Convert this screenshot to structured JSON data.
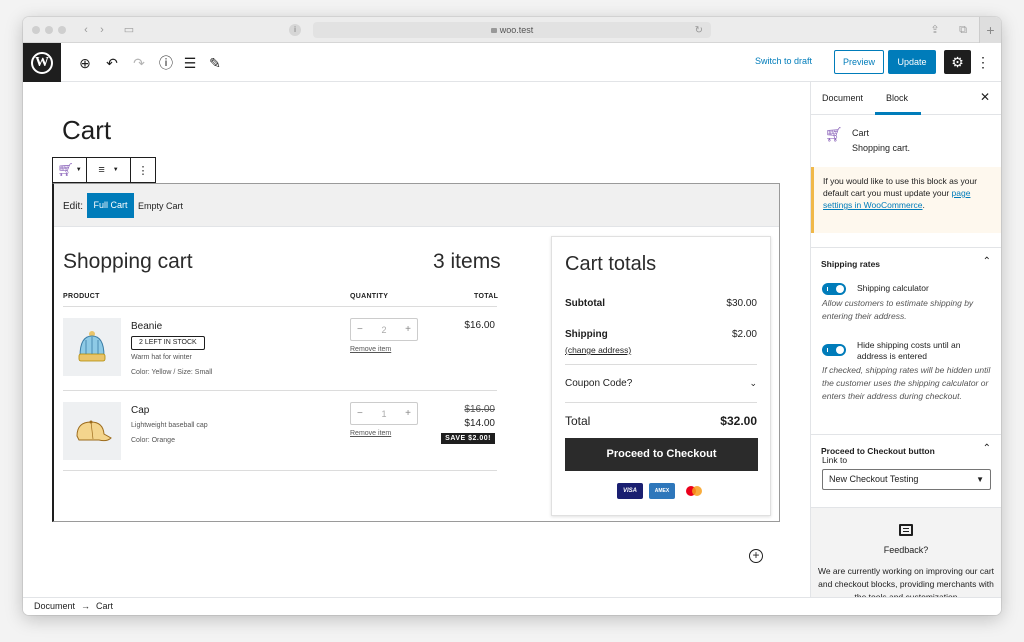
{
  "browser": {
    "url": "woo.test"
  },
  "toolbar": {
    "switch_draft": "Switch to draft",
    "preview": "Preview",
    "update": "Update"
  },
  "page": {
    "title": "Cart"
  },
  "block": {
    "edit_label": "Edit:",
    "full_cart": "Full Cart",
    "empty_cart": "Empty Cart"
  },
  "cart": {
    "title": "Shopping cart",
    "count": "3 items",
    "col_product": "PRODUCT",
    "col_quantity": "QUANTITY",
    "col_total": "TOTAL",
    "remove_label": "Remove item",
    "items": [
      {
        "name": "Beanie",
        "stock": "2 LEFT IN STOCK",
        "desc": "Warm hat for winter",
        "attrs": "Color: Yellow / Size: Small",
        "qty": "2",
        "price": "$16.00"
      },
      {
        "name": "Cap",
        "desc": "Lightweight baseball cap",
        "attrs": "Color: Orange",
        "qty": "1",
        "old_price": "$16.00",
        "price": "$14.00",
        "save": "SAVE $2.00!"
      }
    ]
  },
  "totals": {
    "title": "Cart totals",
    "subtotal_label": "Subtotal",
    "subtotal": "$30.00",
    "shipping_label": "Shipping",
    "shipping": "$2.00",
    "change_address": "(change address)",
    "coupon": "Coupon Code?",
    "total_label": "Total",
    "total": "$32.00",
    "checkout": "Proceed to Checkout",
    "cards": [
      "VISA",
      "AMEX",
      "MC"
    ]
  },
  "sidebar": {
    "tab_document": "Document",
    "tab_block": "Block",
    "block_name": "Cart",
    "block_desc": "Shopping cart.",
    "notice_pre": "If you would like to use this block as your default cart you must update your ",
    "notice_link": "page settings in WooCommerce",
    "notice_post": ".",
    "shipping_rates_title": "Shipping rates",
    "toggle1_label": "Shipping calculator",
    "toggle1_help": "Allow customers to estimate shipping by entering their address.",
    "toggle2_label": "Hide shipping costs until an address is entered",
    "toggle2_help": "If checked, shipping rates will be hidden until the customer uses the shipping calculator or enters their address during checkout.",
    "checkout_button_title": "Proceed to Checkout button",
    "link_to_label": "Link to",
    "link_to_value": "New Checkout Testing",
    "feedback_title": "Feedback?",
    "feedback_text": "We are currently working on improving our cart and checkout blocks, providing merchants with the tools and customization"
  },
  "breadcrumb": {
    "root": "Document",
    "current": "Cart"
  },
  "colors": {
    "accent": "#007cba",
    "woo_purple": "#7f54b3",
    "dark": "#1e1e1e"
  }
}
